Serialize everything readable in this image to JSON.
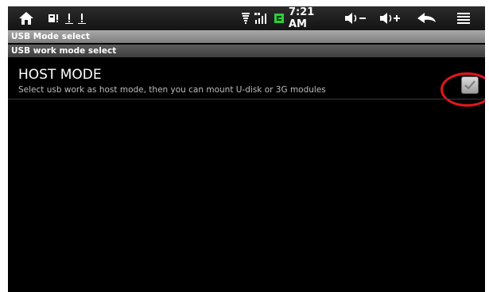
{
  "status_bar": {
    "time": "7:21 AM",
    "icons": {
      "home": "home-icon",
      "notification_1": "notification-icon",
      "warning_1": "warning-icon",
      "warning_2": "warning-icon",
      "wifi": "wifi-icon",
      "signal": "signal-icon",
      "battery": "battery-icon",
      "volume_down": "volume-down-icon",
      "volume_up": "volume-up-icon",
      "back": "back-icon",
      "menu": "menu-icon"
    }
  },
  "screen": {
    "title": "USB Mode select",
    "section_header": "USB work mode select",
    "preference": {
      "title": "HOST MODE",
      "summary": "Select usb work as host mode, then you can mount U-disk or 3G modules",
      "checked": true
    }
  },
  "colors": {
    "background": "#000000",
    "highlight_circle": "#e8141b",
    "title_bar": "#8f8f8f",
    "section_header": "#4a4a4a"
  }
}
